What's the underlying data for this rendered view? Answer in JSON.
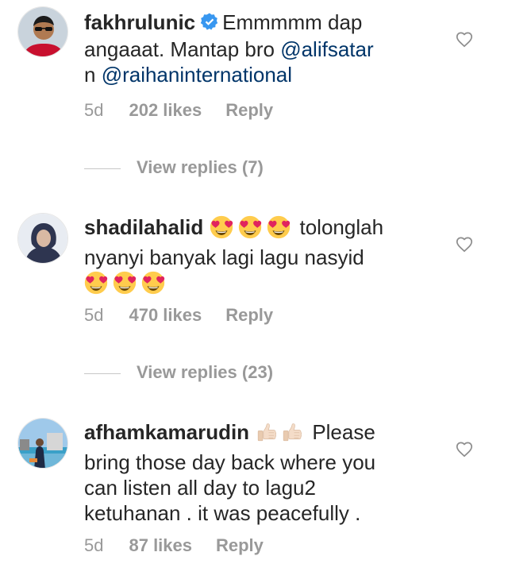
{
  "comments": [
    {
      "username": "fakhrulunic",
      "verified": true,
      "text_line1": "Emmmmm dap",
      "text_line2": "angaaat. Mantap bro ",
      "mention1": "@alifsatar",
      "text_line3": "n ",
      "mention2": "@raihaninternational",
      "time": "5d",
      "likes": "202 likes",
      "reply": "Reply",
      "view_replies": "View replies (7)"
    },
    {
      "username": "shadilahalid",
      "emoji_text": "tolonglah",
      "text_line2": "nyanyi banyak lagi lagu nasyid",
      "time": "5d",
      "likes": "470 likes",
      "reply": "Reply",
      "view_replies": "View replies (23)"
    },
    {
      "username": "afhamkamarudin",
      "text_line1": "Please",
      "text_line2": "bring those day back where you",
      "text_line3": "can listen all day to lagu2",
      "text_line4": "ketuhanan . it was peacefully .",
      "time": "5d",
      "likes": "87 likes",
      "reply": "Reply"
    }
  ],
  "icons": {
    "heart": "heart-outline-icon",
    "verified": "verified-badge-icon",
    "emoji_heart_eyes": "heart-eyes-emoji",
    "emoji_thumbs_up": "thumbs-up-emoji"
  },
  "colors": {
    "text": "#262626",
    "meta": "#999999",
    "mention": "#003569",
    "verified": "#3897f0"
  }
}
